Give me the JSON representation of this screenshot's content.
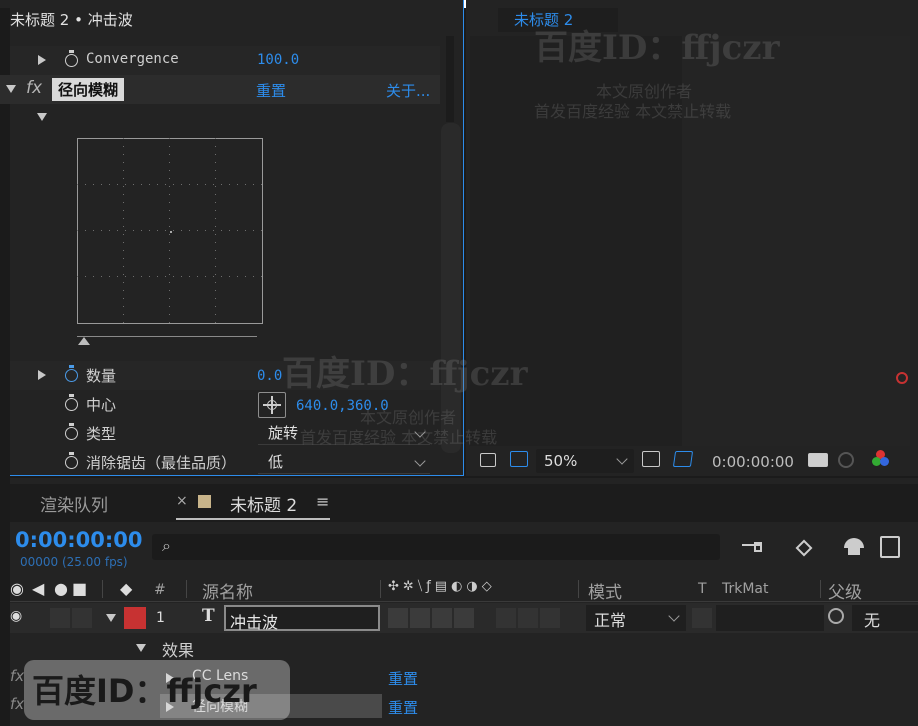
{
  "window_title": "未标题 2 • 冲击波",
  "effect_controls": {
    "convergence": {
      "label": "Convergence",
      "value": "100.0"
    },
    "effect": {
      "fx": "fx",
      "name": "径向模糊",
      "reset": "重置",
      "about": "关于..."
    },
    "amount": {
      "label": "数量",
      "value": "0.0"
    },
    "center": {
      "label": "中心",
      "value": "640.0,360.0"
    },
    "type": {
      "label": "类型",
      "value": "旋转"
    },
    "antialias": {
      "label": "消除锯齿（最佳品质）",
      "value": "低"
    }
  },
  "composition": {
    "tab": "未标题 2",
    "zoom": "50%",
    "timecode": "0:00:00:00"
  },
  "timeline": {
    "tabs": {
      "render_queue": "渲染队列",
      "close": "×",
      "comp": "未标题 2",
      "menu": "≡"
    },
    "timecode": "0:00:00:00",
    "fps": "00000 (25.00 fps)",
    "search_glyph": "⌕",
    "columns": {
      "num": "#",
      "source": "源名称",
      "mode": "模式",
      "t": "T",
      "trkmat": "TrkMat",
      "parent": "父级"
    },
    "layer": {
      "index": "1",
      "type": "T",
      "name": "冲击波",
      "mode": "正常",
      "parent": "无"
    },
    "effects_group": "效果",
    "effects": [
      {
        "name": "CC Lens",
        "reset": "重置"
      },
      {
        "name": "径向模糊",
        "reset": "重置"
      }
    ]
  },
  "watermark": {
    "id": "百度ID：ffjczr",
    "line1": "本文原创作者",
    "line2": "首发百度经验  本文禁止转载"
  },
  "colors": {
    "accent": "#2d8ceb",
    "label_red": "#c73232",
    "panel": "#232323"
  }
}
